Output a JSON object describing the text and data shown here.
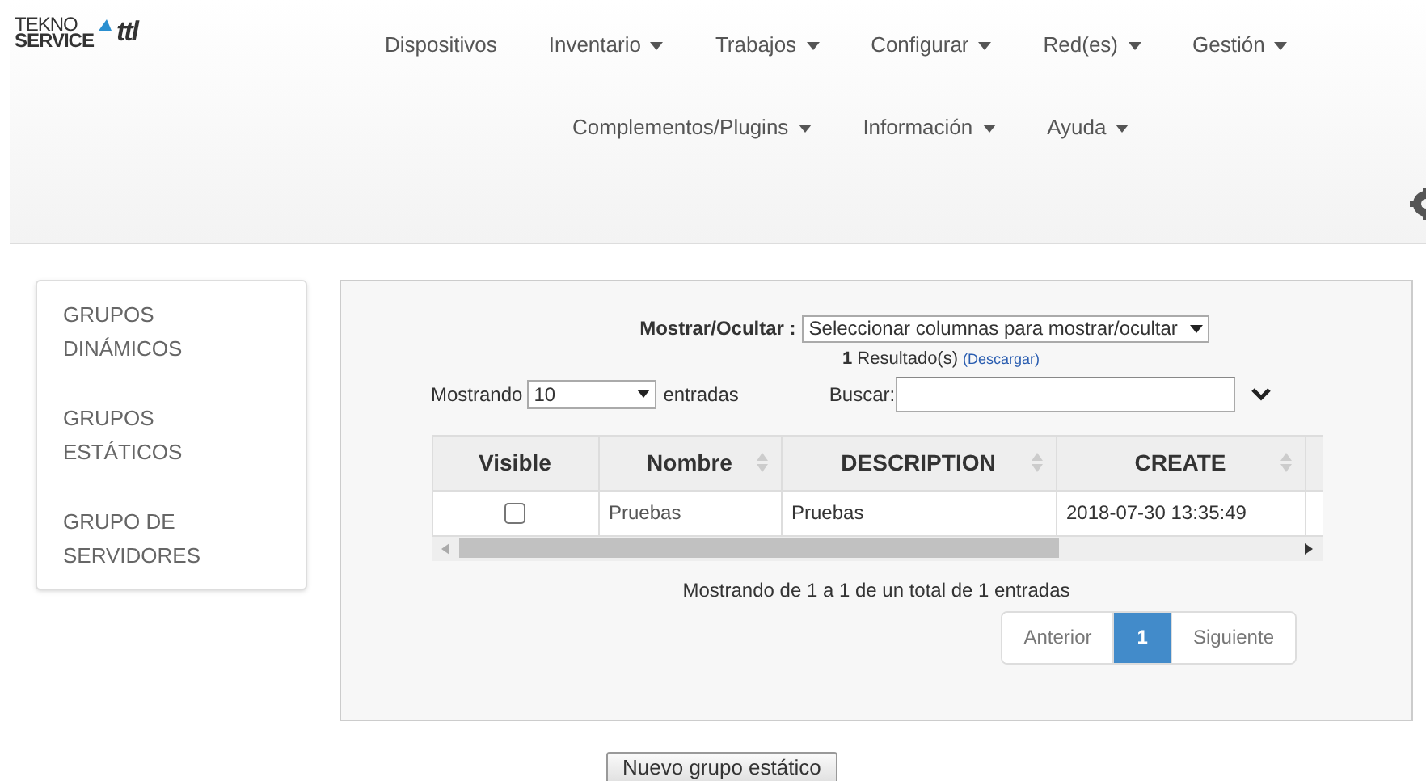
{
  "logo": {
    "line_1": "TEKNO",
    "line_2": "SERVICE",
    "mark": "ttl"
  },
  "nav": [
    {
      "label": "Dispositivos",
      "has_menu": false
    },
    {
      "label": "Inventario",
      "has_menu": true
    },
    {
      "label": "Trabajos",
      "has_menu": true
    },
    {
      "label": "Configurar",
      "has_menu": true
    },
    {
      "label": "Red(es)",
      "has_menu": true
    },
    {
      "label": "Gestión",
      "has_menu": true
    },
    {
      "label": "Complementos/Plugins",
      "has_menu": true
    },
    {
      "label": "Información",
      "has_menu": true
    },
    {
      "label": "Ayuda",
      "has_menu": true
    }
  ],
  "sidebar": {
    "items": [
      "GRUPOS DINÁMICOS",
      "GRUPOS ESTÁTICOS",
      "GRUPO DE SERVIDORES"
    ]
  },
  "columns_toggle": {
    "label": "Mostrar/Ocultar :",
    "value": "Seleccionar columnas para mostrar/ocultar"
  },
  "results": {
    "count": "1",
    "label": "Resultado(s)",
    "link": "(Descargar)"
  },
  "length": {
    "prefix": "Mostrando",
    "value": "10",
    "suffix": "entradas"
  },
  "search": {
    "label": "Buscar:"
  },
  "table": {
    "columns": [
      {
        "label": "Visible",
        "sortable": false
      },
      {
        "label": "Nombre",
        "sortable": true
      },
      {
        "label": "DESCRIPTION",
        "sortable": true
      },
      {
        "label": "CREATE",
        "sortable": true
      }
    ],
    "rows": [
      {
        "visible": {
          "checked": false
        },
        "nombre": "Pruebas",
        "description": "Pruebas",
        "create": "2018-07-30 13:35:49"
      }
    ]
  },
  "info": "Mostrando de 1 a 1 de un total de 1 entradas",
  "pagination": [
    {
      "label": "Anterior",
      "selected": false
    },
    {
      "label": "1",
      "selected": true
    },
    {
      "label": "Siguiente",
      "selected": false
    }
  ],
  "new_button": "Nuevo grupo estático"
}
